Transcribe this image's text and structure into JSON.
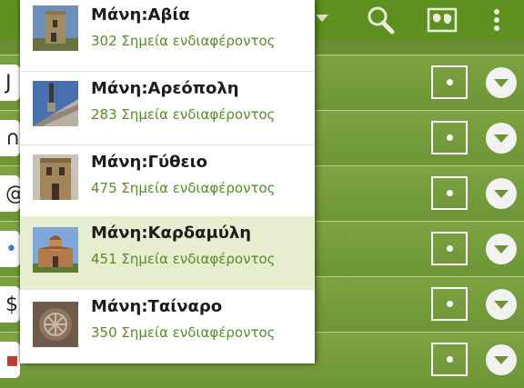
{
  "menu": {
    "items": [
      {
        "title": "Μάνη:Αβία",
        "subtitle": "302 Σημεία ενδιαφέροντος",
        "selected": false,
        "thumb": "stone-tower-image"
      },
      {
        "title": "Μάνη:Αρεόπολη",
        "subtitle": "283 Σημεία ενδιαφέροντος",
        "selected": false,
        "thumb": "statue-steps-image"
      },
      {
        "title": "Μάνη:Γύθειο",
        "subtitle": "475 Σημεία ενδιαφέροντος",
        "selected": false,
        "thumb": "stone-house-image"
      },
      {
        "title": "Μάνη:Καρδαμύλη",
        "subtitle": "451 Σημεία ενδιαφέροντος",
        "selected": true,
        "thumb": "byzantine-church-image"
      },
      {
        "title": "Μάνη:Ταίναρο",
        "subtitle": "350 Σημεία ενδιαφέροντος",
        "selected": false,
        "thumb": "carved-stone-image"
      }
    ]
  },
  "actionbar": {
    "icons": [
      "search-icon",
      "map-icon",
      "overflow-menu-icon"
    ]
  },
  "list": {
    "rows": [
      {
        "left_glyph": "J"
      },
      {
        "left_glyph": "∩"
      },
      {
        "left_glyph": "@"
      },
      {
        "left_glyph": "•"
      },
      {
        "left_glyph": "$"
      },
      {
        "left_glyph": "▪"
      }
    ]
  },
  "colors": {
    "accent": "#5f8f1f",
    "subtitle": "#5a8a2a",
    "selected_bg": "#e6eecf"
  }
}
